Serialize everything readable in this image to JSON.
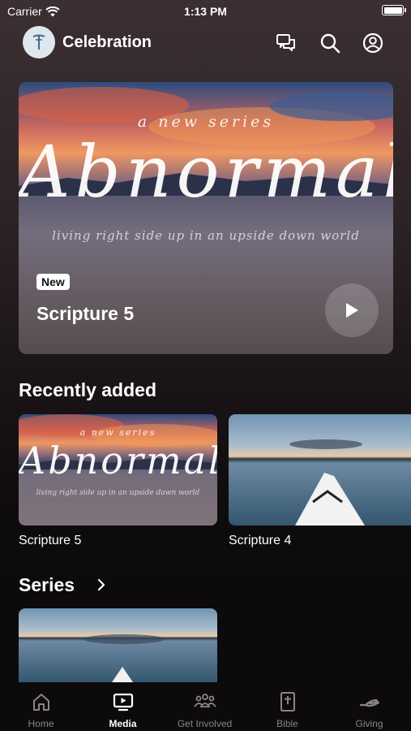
{
  "status_bar": {
    "carrier": "Carrier",
    "time": "1:13 PM"
  },
  "header": {
    "title": "Celebration"
  },
  "hero": {
    "art_text": {
      "kicker": "a new series",
      "title": "Abnormal",
      "tagline": "living right side up in an upside down world"
    },
    "badge": "New",
    "title": "Scripture 5"
  },
  "recently_added": {
    "title": "Recently added",
    "items": [
      {
        "label": "Scripture 5",
        "art_kicker": "a new series",
        "art_title": "Abnormal",
        "art_tagline": "living right side up in an upside down world"
      },
      {
        "label": "Scripture 4"
      }
    ]
  },
  "series": {
    "title": "Series"
  },
  "tabs": [
    {
      "label": "Home",
      "icon": "home-icon"
    },
    {
      "label": "Media",
      "icon": "media-icon"
    },
    {
      "label": "Get Involved",
      "icon": "people-icon"
    },
    {
      "label": "Bible",
      "icon": "bible-icon"
    },
    {
      "label": "Giving",
      "icon": "giving-icon"
    }
  ],
  "colors": {
    "tab_active": "#ffffff",
    "tab_inactive": "#8a8587",
    "badge_bg": "#ffffff"
  }
}
